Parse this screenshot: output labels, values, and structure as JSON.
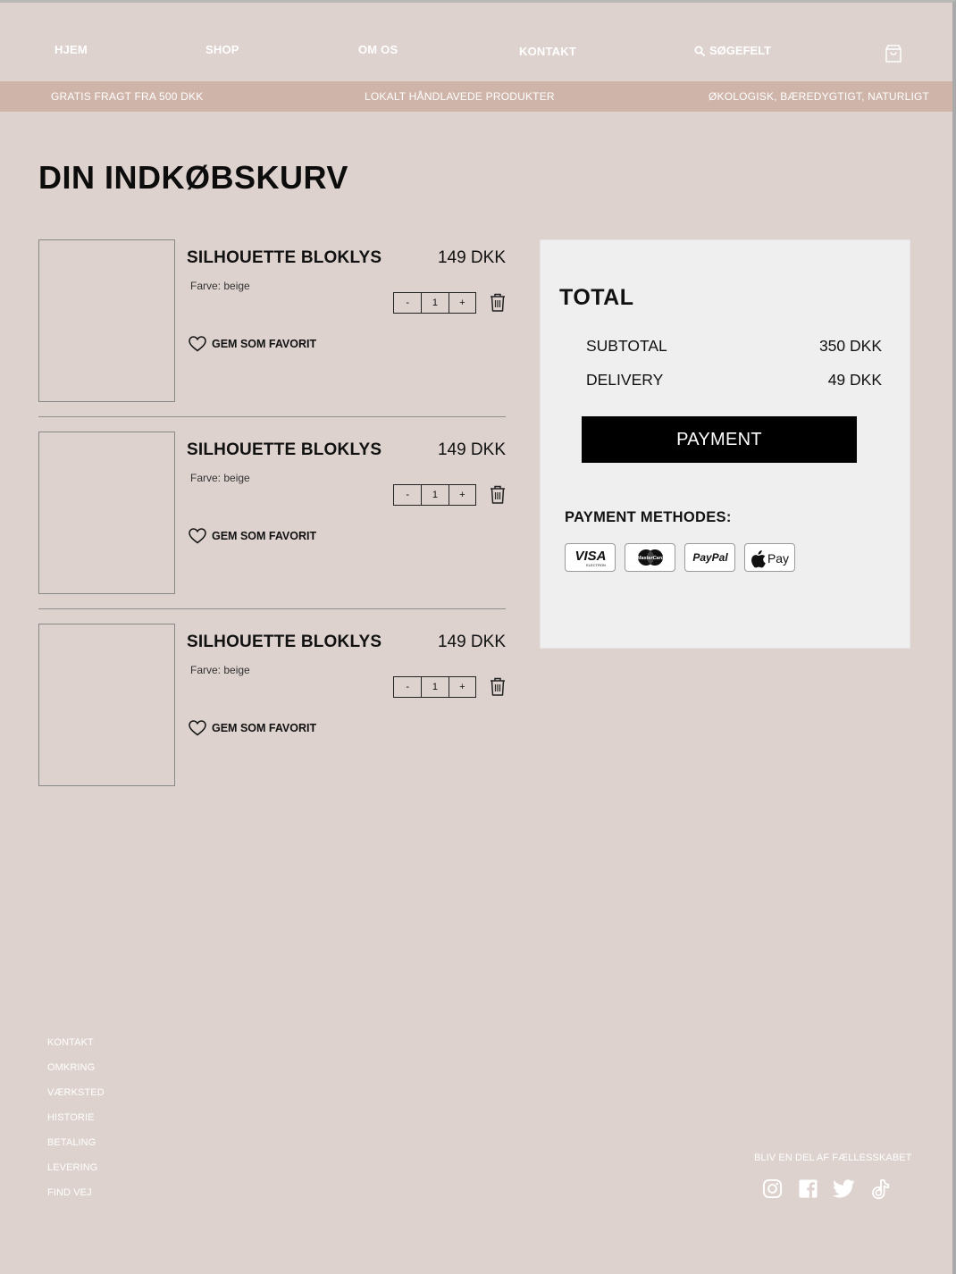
{
  "nav": {
    "home": "HJEM",
    "shop": "SHOP",
    "about": "OM OS",
    "contact": "KONTAKT",
    "search": "SØGEFELT"
  },
  "promo": {
    "shipping": "GRATIS FRAGT FRA 500 DKK",
    "local": "LOKALT HÅNDLAVEDE PRODUKTER",
    "eco": "ØKOLOGISK, BÆREDYGTIGT, NATURLIGT"
  },
  "page_title": "DIN INDKØBSKURV",
  "items": [
    {
      "name": "SILHOUETTE BLOKLYS",
      "price": "149 DKK",
      "color": "Farve: beige",
      "qty": "1",
      "minus": "-",
      "plus": "+",
      "favorite": "GEM SOM FAVORIT"
    },
    {
      "name": "SILHOUETTE BLOKLYS",
      "price": "149 DKK",
      "color": "Farve: beige",
      "qty": "1",
      "minus": "-",
      "plus": "+",
      "favorite": "GEM SOM FAVORIT"
    },
    {
      "name": "SILHOUETTE BLOKLYS",
      "price": "149 DKK",
      "color": "Farve: beige",
      "qty": "1",
      "minus": "-",
      "plus": "+",
      "favorite": "GEM SOM FAVORIT"
    }
  ],
  "summary": {
    "total_label": "TOTAL",
    "subtotal_label": "SUBTOTAL",
    "subtotal_value": "350 DKK",
    "delivery_label": "DELIVERY",
    "delivery_value": "49 DKK",
    "payment_button": "PAYMENT",
    "methods_label": "PAYMENT METHODES:",
    "methods": [
      "VISA",
      "MasterCard",
      "PayPal",
      "Pay"
    ],
    "visa_sub": "ELECTRON"
  },
  "footer": {
    "links": [
      "KONTAKT",
      "OMKRING",
      "VÆRKSTED",
      "HISTORIE",
      "BETALING",
      "LEVERING",
      "FIND VEJ"
    ],
    "community": "BLIV EN DEL AF FÆLLESSKABET",
    "socials": [
      "instagram-icon",
      "facebook-icon",
      "twitter-icon",
      "tiktok-icon"
    ]
  },
  "colors": {
    "background": "#ddd2ce",
    "promo_bar": "#cfb4aa",
    "summary_panel": "#efefef",
    "button": "#000000"
  }
}
